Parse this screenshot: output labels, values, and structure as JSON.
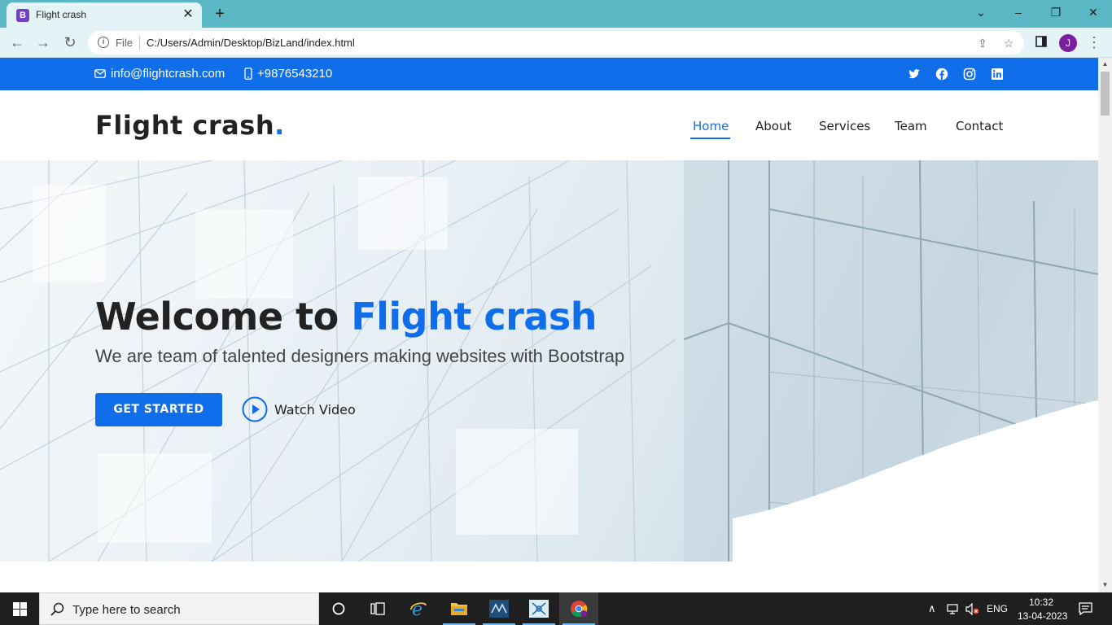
{
  "browser": {
    "tab_title": "Flight crash",
    "tab_favicon_letter": "B",
    "address_scheme": "File",
    "address_url": "C:/Users/Admin/Desktop/BizLand/index.html",
    "profile_initial": "J"
  },
  "site": {
    "topbar": {
      "email": "info@flightcrash.com",
      "phone": "+9876543210",
      "social_icons": [
        "twitter-icon",
        "facebook-icon",
        "instagram-icon",
        "linkedin-icon"
      ]
    },
    "logo": {
      "text": "Flight crash",
      "dot": "."
    },
    "nav": [
      {
        "label": "Home",
        "active": true
      },
      {
        "label": "About",
        "active": false
      },
      {
        "label": "Services",
        "active": false
      },
      {
        "label": "Team",
        "active": false
      },
      {
        "label": "Contact",
        "active": false
      }
    ],
    "hero": {
      "title_prefix": "Welcome to ",
      "title_accent": "Flight crash",
      "subtitle": "We are team of talented designers making websites with Bootstrap",
      "cta_label": "GET STARTED",
      "video_label": "Watch Video"
    },
    "colors": {
      "accent": "#106eea",
      "text_dark": "#222222"
    }
  },
  "taskbar": {
    "search_placeholder": "Type here to search",
    "apps": [
      "cortana-icon",
      "task-view-icon",
      "internet-explorer-icon",
      "file-explorer-icon",
      "mysql-workbench-icon",
      "snipping-icon",
      "chrome-icon"
    ],
    "language": "ENG",
    "time": "10:32",
    "date": "13-04-2023"
  }
}
